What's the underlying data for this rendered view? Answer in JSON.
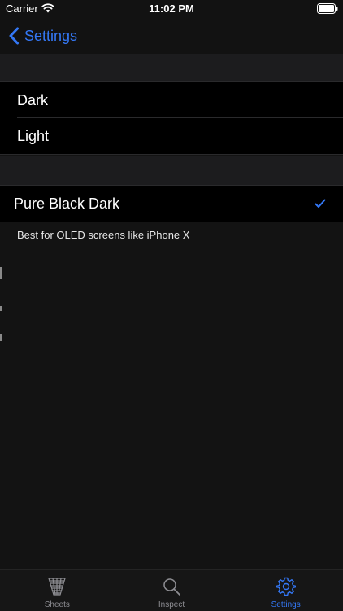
{
  "status_bar": {
    "carrier": "Carrier",
    "time": "11:02 PM"
  },
  "nav": {
    "back_label": "Settings"
  },
  "theme_options": [
    {
      "label": "Dark",
      "selected": false
    },
    {
      "label": "Light",
      "selected": false
    }
  ],
  "black_option": {
    "label": "Pure Black Dark",
    "selected": true,
    "footer": "Best for OLED screens like iPhone X"
  },
  "tabs": [
    {
      "label": "Sheets",
      "icon": "sheets-icon",
      "active": false
    },
    {
      "label": "Inspect",
      "icon": "magnifier-icon",
      "active": false
    },
    {
      "label": "Settings",
      "icon": "gear-icon",
      "active": true
    }
  ],
  "colors": {
    "accent": "#3478f6",
    "background": "#131313",
    "row_background": "#000000",
    "inactive_tab": "#8e8e93"
  }
}
